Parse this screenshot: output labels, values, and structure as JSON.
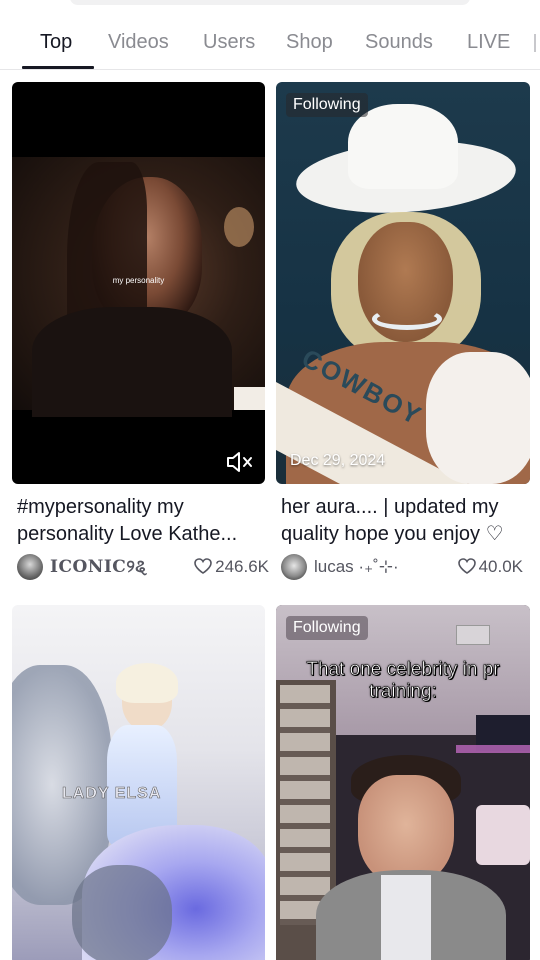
{
  "tabs": [
    "Top",
    "Videos",
    "Users",
    "Shop",
    "Sounds",
    "LIVE"
  ],
  "active_tab": "Top",
  "results": [
    {
      "caption_bold": "#mypersonality my personality",
      "caption_rest": "Love Kathe...",
      "username": "ICONIC୨ୡ",
      "likes": "246.6K",
      "overlay_text": "my personality",
      "mute_icon": "speaker-muted-icon"
    },
    {
      "badge": "Following",
      "date": "Dec 29, 2024",
      "caption_rest": "her aura....  | updated",
      "caption_bold": "my",
      "caption_rest2": "quality hope you enjoy ♡",
      "username": "lucas ·₊˚⊹·",
      "likes": "40.0K",
      "overlay_text": "COWBOY"
    },
    {
      "overlay_text": "LADY ELSA"
    },
    {
      "badge": "Following",
      "overlay_text": "That one celebrity in pr training:"
    }
  ],
  "colors": {
    "text": "#161823",
    "muted": "#8a8b91",
    "meta": "#555660"
  }
}
